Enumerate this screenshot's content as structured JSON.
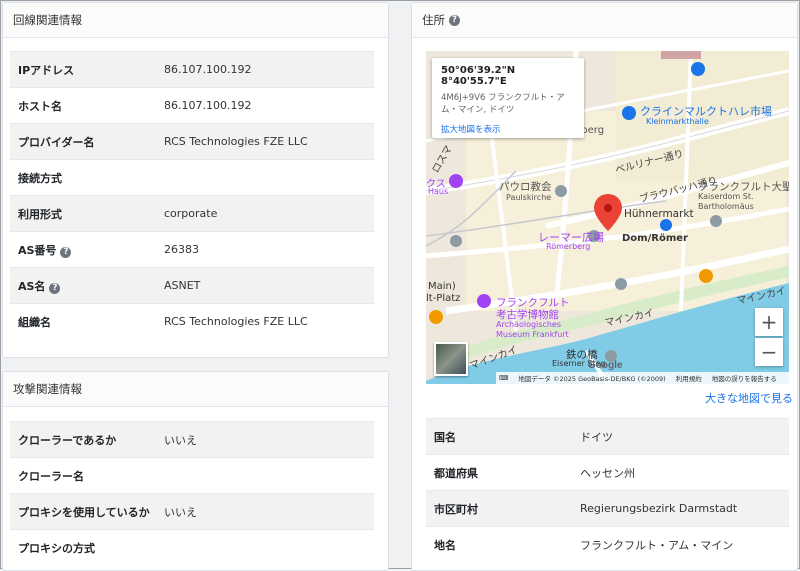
{
  "line_info": {
    "title": "回線関連情報",
    "rows": [
      {
        "label": "IPアドレス",
        "value": "86.107.100.192"
      },
      {
        "label": "ホスト名",
        "value": "86.107.100.192"
      },
      {
        "label": "プロバイダー名",
        "value": "RCS Technologies FZE LLC"
      },
      {
        "label": "接続方式",
        "value": ""
      },
      {
        "label": "利用形式",
        "value": "corporate"
      },
      {
        "label": "AS番号",
        "value": "26383",
        "help": true
      },
      {
        "label": "AS名",
        "value": "ASNET",
        "help": true
      },
      {
        "label": "組織名",
        "value": "RCS Technologies FZE LLC"
      }
    ]
  },
  "attack_info": {
    "title": "攻撃関連情報",
    "rows": [
      {
        "label": "クローラーであるか",
        "value": "いいえ"
      },
      {
        "label": "クローラー名",
        "value": ""
      },
      {
        "label": "プロキシを使用しているか",
        "value": "いいえ"
      },
      {
        "label": "プロキシの方式",
        "value": ""
      }
    ]
  },
  "address": {
    "title": "住所",
    "help_glyph": "?",
    "map": {
      "coords": "50°06'39.2\"N 8°40'55.7\"E",
      "plus_code_address": "4M6J+9V6 フランクフルト・アム・マイン, ドイツ",
      "enlarge_link": "拡大地図を表示",
      "zoom_in": "+",
      "zoom_out": "−",
      "google_logo": "Google",
      "attribution": {
        "data": "地図データ ©2025 GeoBasis-DE/BKG (©2009)",
        "terms": "利用規約",
        "report": "地図の誤りを報告する"
      },
      "labels": {
        "klein": "クラインマルクトハレ市場",
        "klein_de": "Kleinmarkthalle",
        "berliner": "ベルリナー通り",
        "paul": "パウロ教会",
        "paul_de": "Paulskirche",
        "braubach": "ブラウバッハ通り",
        "dom": "フランクフルト大聖",
        "dom_de1": "Kaiserdom St.",
        "dom_de2": "Bartholomäus",
        "huhner": "Hühnermarkt",
        "romer": "レーマー広場",
        "romer_de": "Römerberg",
        "domromer": "Dom/Römer",
        "museum": "フランクフルト",
        "museum2": "考古学博物館",
        "museum_de1": "Archäologisches",
        "museum_de2": "Museum Frankfurt",
        "mainkai": "マインカイ",
        "mainkai2": "マインカイ",
        "mainkai3": "マインカイ",
        "eiserner": "鉄の橋",
        "eiserner_de": "Eiserner Steg",
        "berg": "rnberg",
        "main_platz": "Main)",
        "platz": "lt-Platz",
        "kusu": "クス",
        "hau": "Haus",
        "rosu": "ロスマ"
      }
    },
    "big_map_link": "大きな地図で見る",
    "rows": [
      {
        "label": "国名",
        "value": "ドイツ"
      },
      {
        "label": "都道府県",
        "value": "ヘッセン州"
      },
      {
        "label": "市区町村",
        "value": "Regierungsbezirk Darmstadt"
      },
      {
        "label": "地名",
        "value": "フランクフルト・アム・マイン"
      }
    ]
  }
}
